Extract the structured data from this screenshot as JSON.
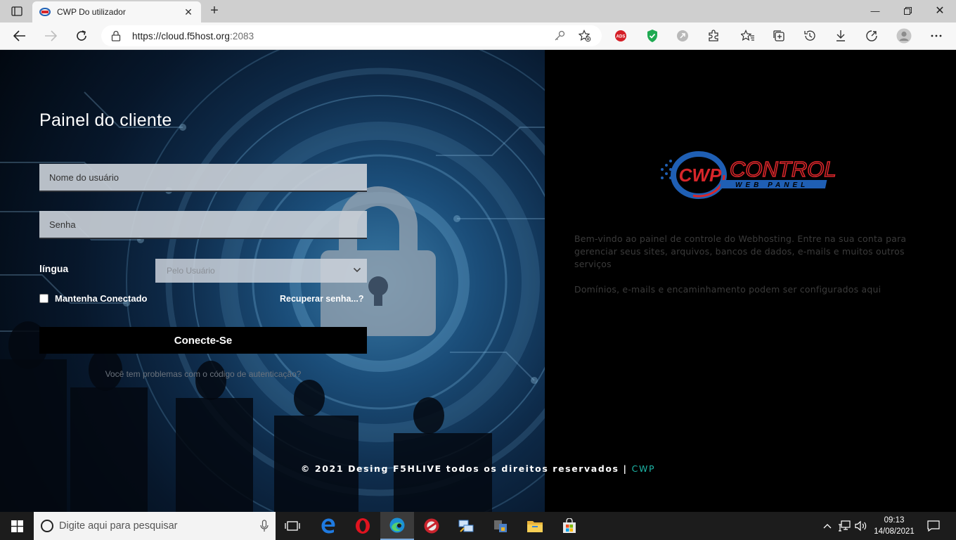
{
  "browser": {
    "tab_title": "CWP Do utilizador",
    "url_main": "https://cloud.f5host.org",
    "url_port": ":2083",
    "ext_ads_label": "ADS"
  },
  "login": {
    "title": "Painel do cliente",
    "username_placeholder": "Nome do usuário",
    "password_placeholder": "Senha",
    "language_label": "língua",
    "language_value": "Pelo Usuário",
    "remember_label": "Mantenha Conectado",
    "recover_label": "Recuperar senha...?",
    "submit_label": "Conecte-Se",
    "auth_problem": "Você tem problemas com o código de autenticação?"
  },
  "info": {
    "logo_main": "CONTROL",
    "logo_cwp": "CWP",
    "logo_sub": "WEB PANEL",
    "welcome": "Bem-vindo ao painel de controle do Webhosting. Entre na sua conta para gerenciar seus sites, arquivos, bancos de dados, e-mails e muitos outros serviços",
    "domains": "Domínios, e-mails e encaminhamento podem ser configurados aqui"
  },
  "footer": {
    "text": "© 2021 Desing F5HLIVE todos os direitos reservados | ",
    "brand": "CWP"
  },
  "taskbar": {
    "search_placeholder": "Digite aqui para pesquisar",
    "time": "09:13",
    "date": "14/08/2021"
  },
  "colors": {
    "accent": "#1db7a8",
    "logo_red": "#d8262a",
    "logo_blue": "#1f5fb4"
  }
}
